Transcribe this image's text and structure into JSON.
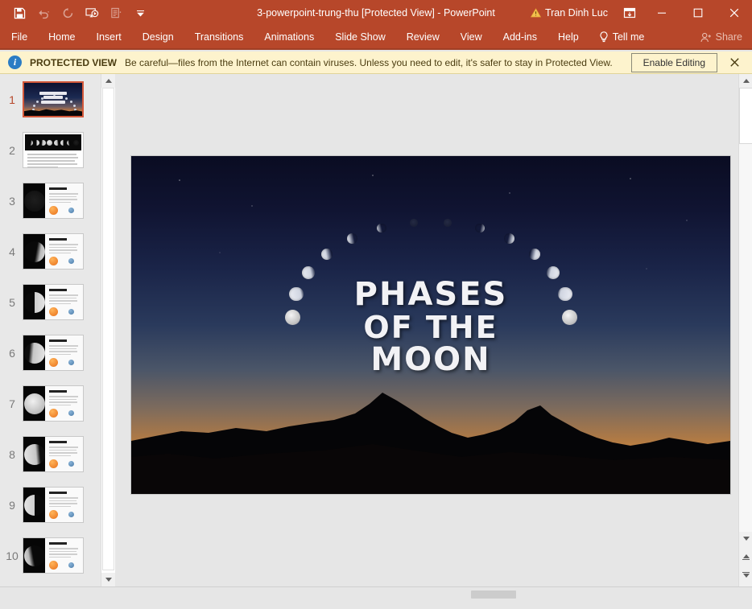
{
  "titlebar": {
    "document_title": "3-powerpoint-trung-thu [Protected View]  -  PowerPoint",
    "user_name": "Tran Dinh Luc",
    "quick_access": [
      {
        "name": "save-button",
        "glyph": "save",
        "enabled": true
      },
      {
        "name": "undo-button",
        "glyph": "undo",
        "enabled": false
      },
      {
        "name": "redo-button",
        "glyph": "redo",
        "enabled": false
      },
      {
        "name": "start-from-beginning-button",
        "glyph": "slideshow",
        "enabled": true
      },
      {
        "name": "presenter-view-button",
        "glyph": "notes",
        "enabled": false
      },
      {
        "name": "customize-quick-access-toolbar-button",
        "glyph": "chevron-down",
        "enabled": true
      }
    ],
    "ribbon_display_options_label": "Ribbon Display Options",
    "minimize_label": "Minimize",
    "restore_label": "Restore Down",
    "close_label": "Close"
  },
  "ribbon": {
    "tabs": [
      "File",
      "Home",
      "Insert",
      "Design",
      "Transitions",
      "Animations",
      "Slide Show",
      "Review",
      "View",
      "Add-ins",
      "Help"
    ],
    "tell_me": "Tell me",
    "share": "Share"
  },
  "protected_view": {
    "label": "PROTECTED VIEW",
    "message": "Be careful—files from the Internet can contain viruses. Unless you need to edit, it's safer to stay in Protected View.",
    "enable_button": "Enable Editing",
    "close_label": "Close Message Bar"
  },
  "thumbnails": {
    "selected": 1,
    "items": [
      {
        "number": "1",
        "type": "title"
      },
      {
        "number": "2",
        "type": "phases"
      },
      {
        "number": "3",
        "type": "content",
        "moon": "new"
      },
      {
        "number": "4",
        "type": "content",
        "moon": "waxing-crescent"
      },
      {
        "number": "5",
        "type": "content",
        "moon": "first-quarter"
      },
      {
        "number": "6",
        "type": "content",
        "moon": "waxing-gibbous"
      },
      {
        "number": "7",
        "type": "content",
        "moon": "full"
      },
      {
        "number": "8",
        "type": "content",
        "moon": "waning-gibbous"
      },
      {
        "number": "9",
        "type": "content",
        "moon": "last-quarter"
      },
      {
        "number": "10",
        "type": "content",
        "moon": "waning-crescent"
      }
    ]
  },
  "slide": {
    "title_line1": "PHASES",
    "title_line2": "OF THE",
    "title_line3": "MOON",
    "background_description": "night-sky-sunset-mountains",
    "colors": {
      "sky_top": "#0a0c22",
      "sky_mid": "#2a3a5c",
      "sunset_glow": "#d08a3e",
      "ground": "#060606",
      "title_text": "#f2f2f5"
    },
    "moon_arc": [
      {
        "phase": "full",
        "illum": 100
      },
      {
        "phase": "waning-gibbous",
        "illum": 82
      },
      {
        "phase": "waning-gibbous",
        "illum": 70
      },
      {
        "phase": "last-quarter",
        "illum": 50
      },
      {
        "phase": "waning-crescent",
        "illum": 30
      },
      {
        "phase": "waning-crescent",
        "illum": 16
      },
      {
        "phase": "new",
        "illum": 5
      },
      {
        "phase": "new",
        "illum": 3
      },
      {
        "phase": "waxing-crescent",
        "illum": 10
      },
      {
        "phase": "waxing-crescent",
        "illum": 26
      },
      {
        "phase": "first-quarter",
        "illum": 50
      },
      {
        "phase": "waxing-gibbous",
        "illum": 72
      },
      {
        "phase": "waxing-gibbous",
        "illum": 86
      },
      {
        "phase": "full",
        "illum": 100
      }
    ]
  },
  "scrollbars": {
    "thumbnail_pane": {
      "up": "scroll-up",
      "down": "scroll-down"
    },
    "slide_pane": {
      "up": "scroll-up",
      "down": "scroll-down",
      "previous_slide": "Previous Slide",
      "next_slide": "Next Slide"
    }
  }
}
